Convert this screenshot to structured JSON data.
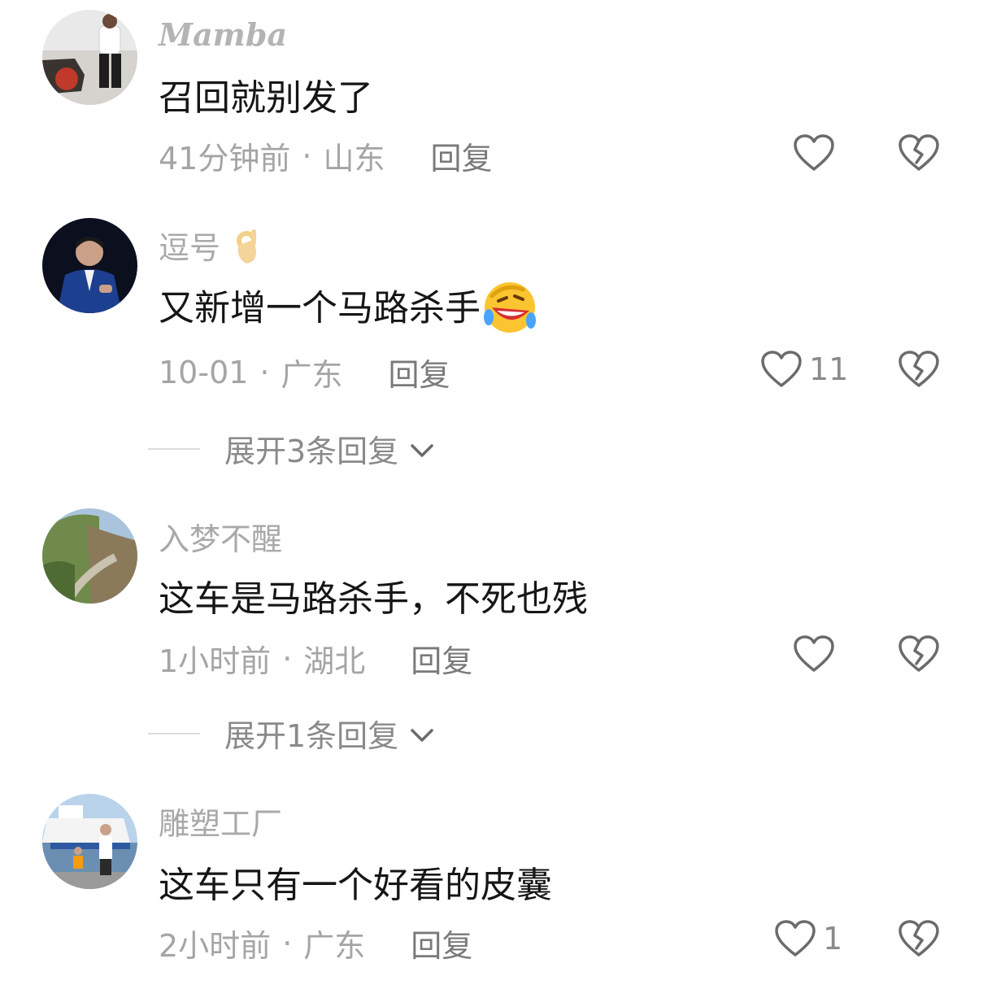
{
  "comments": [
    {
      "username": "Mamba",
      "text": "召回就别发了",
      "time": "41分钟前",
      "location": "山东",
      "reply_label": "回复",
      "likes": ""
    },
    {
      "username": "逗号",
      "username_emoji": "ok-hand-emoji",
      "text": "又新增一个马路杀手",
      "text_emoji": "rolling-laughing-emoji",
      "time": "10-01",
      "location": "广东",
      "reply_label": "回复",
      "likes": "11",
      "expand_label": "展开3条回复"
    },
    {
      "username": "入梦不醒",
      "text": "这车是马路杀手，不死也残",
      "time": "1小时前",
      "location": "湖北",
      "reply_label": "回复",
      "likes": "",
      "expand_label": "展开1条回复"
    },
    {
      "username": "雕塑工厂",
      "text": "这车只有一个好看的皮囊",
      "time": "2小时前",
      "location": "广东",
      "reply_label": "回复",
      "likes": "1"
    }
  ],
  "separator": "·",
  "icons": {
    "like": "heart-outline-icon",
    "dislike": "broken-heart-icon",
    "expand": "chevron-down-icon"
  },
  "colors": {
    "username": "#a9a9a9",
    "text": "#161616",
    "meta": "#a5a5a5",
    "icon_stroke": "#6b6b6b"
  }
}
